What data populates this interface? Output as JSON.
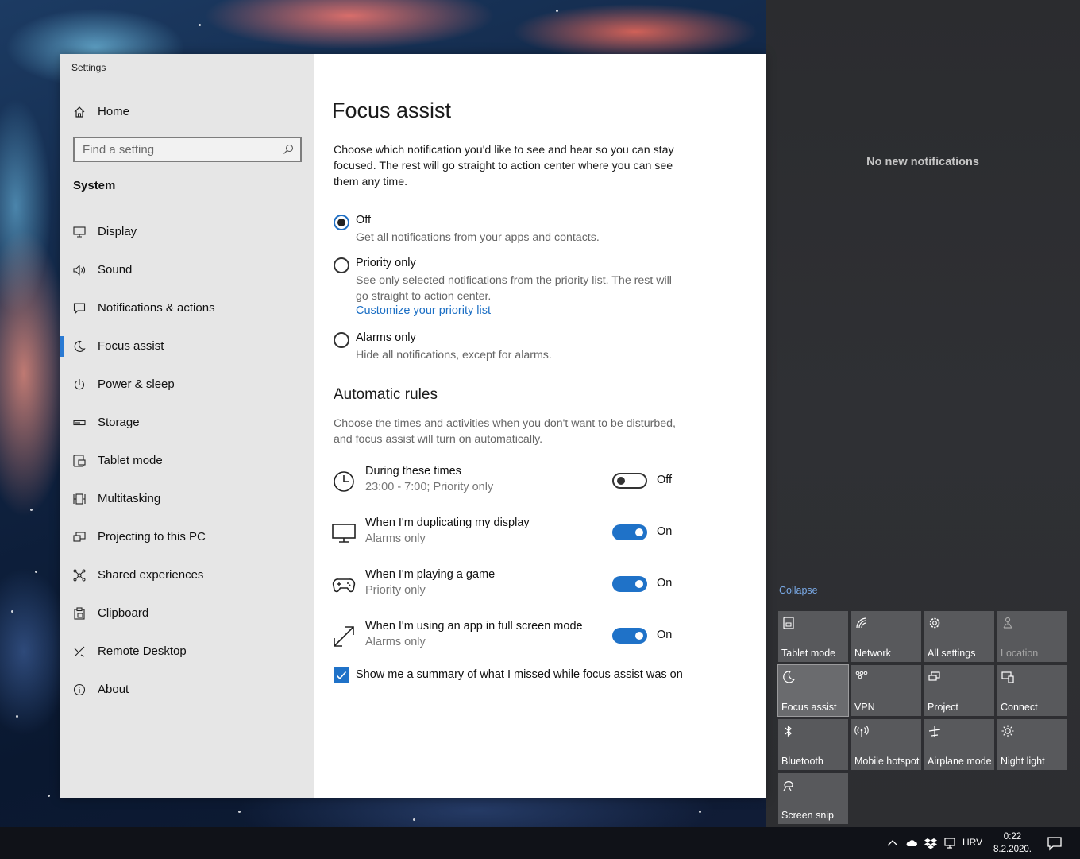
{
  "window": {
    "title": "Settings"
  },
  "sidebar": {
    "home_label": "Home",
    "search_placeholder": "Find a setting",
    "section_title": "System",
    "items": [
      {
        "label": "Display",
        "icon": "monitor-icon"
      },
      {
        "label": "Sound",
        "icon": "speaker-icon"
      },
      {
        "label": "Notifications & actions",
        "icon": "message-icon"
      },
      {
        "label": "Focus assist",
        "icon": "moon-icon",
        "selected": true
      },
      {
        "label": "Power & sleep",
        "icon": "power-icon"
      },
      {
        "label": "Storage",
        "icon": "storage-icon"
      },
      {
        "label": "Tablet mode",
        "icon": "tablet-icon"
      },
      {
        "label": "Multitasking",
        "icon": "multitasking-icon"
      },
      {
        "label": "Projecting to this PC",
        "icon": "projecting-icon"
      },
      {
        "label": "Shared experiences",
        "icon": "shared-icon"
      },
      {
        "label": "Clipboard",
        "icon": "clipboard-icon"
      },
      {
        "label": "Remote Desktop",
        "icon": "remote-desktop-icon"
      },
      {
        "label": "About",
        "icon": "info-icon"
      }
    ]
  },
  "main": {
    "title": "Focus assist",
    "description": "Choose which notification you'd like to see and hear so you can stay focused. The rest will go straight to action center where you can see them any time.",
    "options": [
      {
        "label": "Off",
        "sub": "Get all notifications from your apps and contacts.",
        "checked": true
      },
      {
        "label": "Priority only",
        "sub": "See only selected notifications from the priority list. The rest will go straight to action center.",
        "link": "Customize your priority list"
      },
      {
        "label": "Alarms only",
        "sub": "Hide all notifications, except for alarms."
      }
    ],
    "rules_title": "Automatic rules",
    "rules_description": "Choose the times and activities when you don't want to be disturbed, and focus assist will turn on automatically.",
    "rules": [
      {
        "title": "During these times",
        "sub": "23:00 - 7:00; Priority only",
        "state": "Off",
        "icon": "clock-icon"
      },
      {
        "title": "When I'm duplicating my display",
        "sub": "Alarms only",
        "state": "On",
        "icon": "display-icon"
      },
      {
        "title": "When I'm playing a game",
        "sub": "Priority only",
        "state": "On",
        "icon": "gamepad-icon"
      },
      {
        "title": "When I'm using an app in full screen mode",
        "sub": "Alarms only",
        "state": "On",
        "icon": "fullscreen-icon"
      }
    ],
    "summary_checkbox": "Show me a summary of what I missed while focus assist was on"
  },
  "action_center": {
    "empty_text": "No new notifications",
    "collapse": "Collapse",
    "tiles": [
      {
        "label": "Tablet mode",
        "icon": "tablet-mode-icon"
      },
      {
        "label": "Network",
        "icon": "network-icon"
      },
      {
        "label": "All settings",
        "icon": "gear-icon"
      },
      {
        "label": "Location",
        "icon": "location-icon",
        "disabled": true
      },
      {
        "label": "Focus assist",
        "icon": "moon-icon",
        "active": true
      },
      {
        "label": "VPN",
        "icon": "vpn-icon"
      },
      {
        "label": "Project",
        "icon": "project-icon"
      },
      {
        "label": "Connect",
        "icon": "connect-icon"
      },
      {
        "label": "Bluetooth",
        "icon": "bluetooth-icon"
      },
      {
        "label": "Mobile hotspot",
        "icon": "hotspot-icon"
      },
      {
        "label": "Airplane mode",
        "icon": "airplane-icon"
      },
      {
        "label": "Night light",
        "icon": "sun-icon"
      },
      {
        "label": "Screen snip",
        "icon": "screen-snip-icon"
      }
    ]
  },
  "taskbar": {
    "language": "HRV",
    "time": "0:22",
    "date": "8.2.2020."
  },
  "colors": {
    "accent": "#1f72c8",
    "link": "#1c6fc4",
    "sidebar_bg": "#e6e6e6",
    "action_center_bg": "#2d2e31",
    "tile_bg": "#58595c"
  }
}
